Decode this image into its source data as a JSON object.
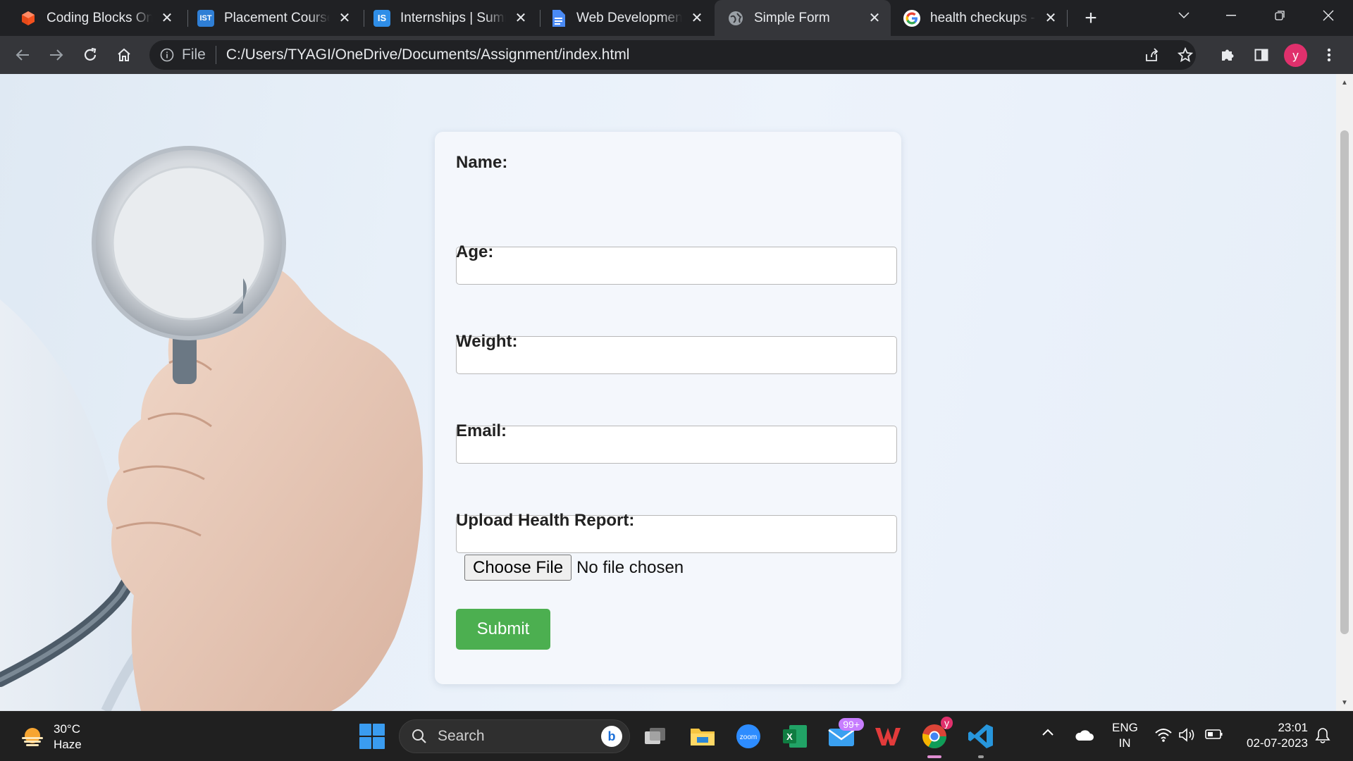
{
  "browser": {
    "tabs": [
      {
        "title": "Coding Blocks Onli",
        "favicon": "coding-blocks-cube-icon",
        "active": false
      },
      {
        "title": "Placement Courses",
        "favicon": "ist-logo-icon",
        "favicon_text": "IST",
        "active": false
      },
      {
        "title": "Internships | Summ",
        "favicon": "is-logo-icon",
        "favicon_text": "IS",
        "active": false
      },
      {
        "title": "Web Development",
        "favicon": "docs-icon",
        "active": false
      },
      {
        "title": "Simple Form",
        "favicon": "globe-icon",
        "active": true
      },
      {
        "title": "health checkups - C",
        "favicon": "google-g-icon",
        "active": false
      }
    ],
    "address": {
      "scheme": "File",
      "url": "C:/Users/TYAGI/OneDrive/Documents/Assignment/index.html"
    },
    "profile_initial": "y"
  },
  "form": {
    "name_label": "Name:",
    "age_label": "Age:",
    "weight_label": "Weight:",
    "email_label": "Email:",
    "upload_label": "Upload Health Report:",
    "choose_file_label": "Choose File",
    "file_status": "No file chosen",
    "submit_label": "Submit"
  },
  "taskbar": {
    "weather": {
      "temp": "30°C",
      "condition": "Haze"
    },
    "search_placeholder": "Search",
    "mail_badge": "99+",
    "chrome_profile_initial": "y",
    "language": {
      "line1": "ENG",
      "line2": "IN"
    },
    "time": "23:01",
    "date": "02-07-2023"
  },
  "colors": {
    "submit_bg": "#4caf50",
    "tab_strip": "#202124",
    "toolbar": "#35363a",
    "profile_avatar": "#e0306c"
  }
}
